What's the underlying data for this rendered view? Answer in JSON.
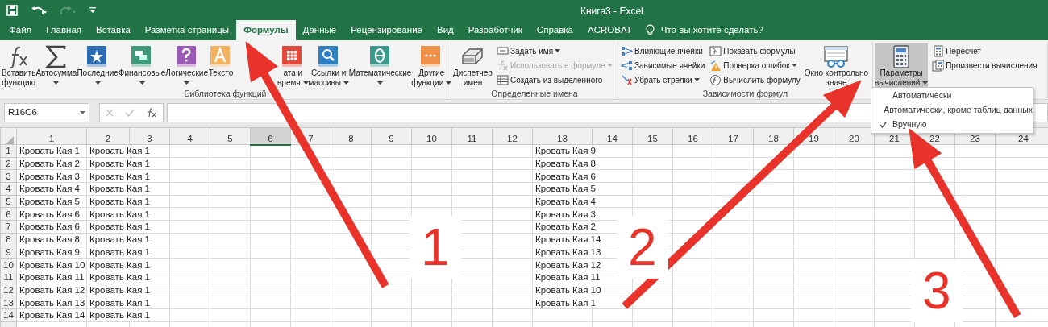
{
  "window": {
    "title": "Книга3  -  Excel"
  },
  "tabs": [
    {
      "label": "Файл",
      "selected": false
    },
    {
      "label": "Главная",
      "selected": false
    },
    {
      "label": "Вставка",
      "selected": false
    },
    {
      "label": "Разметка страницы",
      "selected": false
    },
    {
      "label": "Формулы",
      "selected": true
    },
    {
      "label": "Данные",
      "selected": false
    },
    {
      "label": "Рецензирование",
      "selected": false
    },
    {
      "label": "Вид",
      "selected": false
    },
    {
      "label": "Разработчик",
      "selected": false
    },
    {
      "label": "Справка",
      "selected": false
    },
    {
      "label": "ACROBAT",
      "selected": false
    }
  ],
  "tell_me": {
    "text": "Что вы хотите сделать?"
  },
  "ribbon": {
    "groups": [
      {
        "label": "Библиотека функций",
        "items": [
          {
            "kind": "large",
            "lines": [
              "Вставить",
              "функцию"
            ],
            "dropdown": false,
            "pressed": false
          },
          {
            "kind": "large",
            "lines": [
              "Автосумма"
            ],
            "dropdown": true,
            "pressed": false
          },
          {
            "kind": "large",
            "lines": [
              "Последние"
            ],
            "dropdown": true,
            "pressed": false
          },
          {
            "kind": "large",
            "lines": [
              "Финансовые"
            ],
            "dropdown": true,
            "pressed": false
          },
          {
            "kind": "large",
            "lines": [
              "Логические"
            ],
            "dropdown": true,
            "pressed": false
          },
          {
            "kind": "large",
            "lines": [
              "Тексто"
            ],
            "dropdown": false,
            "pressed": false
          },
          {
            "kind": "large",
            "lines": [
              "ата и",
              "время"
            ],
            "dropdown": true,
            "pressed": false
          },
          {
            "kind": "large",
            "lines": [
              "Ссылки и",
              "массивы"
            ],
            "dropdown": true,
            "pressed": false
          },
          {
            "kind": "large",
            "lines": [
              "Математические"
            ],
            "dropdown": true,
            "pressed": false
          },
          {
            "kind": "large",
            "lines": [
              "Другие",
              "функции"
            ],
            "dropdown": true,
            "pressed": false
          }
        ]
      },
      {
        "label": "Определенные имена",
        "items": [
          {
            "kind": "large",
            "lines": [
              "Диспетчер",
              "имен"
            ],
            "dropdown": false,
            "pressed": false
          },
          {
            "kind": "stack",
            "items": [
              {
                "label": "Задать имя",
                "dropdown": true,
                "disabled": false
              },
              {
                "label": "Использовать в формуле",
                "dropdown": true,
                "disabled": true
              },
              {
                "label": "Создать из выделенного",
                "dropdown": false,
                "disabled": false
              }
            ]
          }
        ]
      },
      {
        "label": "Зависимости формул",
        "items": [
          {
            "kind": "stack",
            "items": [
              {
                "label": "Влияющие ячейки",
                "dropdown": false,
                "disabled": false
              },
              {
                "label": "Зависимые ячейки",
                "dropdown": false,
                "disabled": false
              },
              {
                "label": "Убрать стрелки",
                "dropdown": true,
                "disabled": false
              }
            ]
          },
          {
            "kind": "stack",
            "items": [
              {
                "label": "Показать формулы",
                "dropdown": false,
                "disabled": false
              },
              {
                "label": "Проверка ошибок",
                "dropdown": true,
                "disabled": false
              },
              {
                "label": "Вычислить формулу",
                "dropdown": false,
                "disabled": false
              }
            ]
          },
          {
            "kind": "large",
            "lines": [
              "Окно контрольно",
              "значе"
            ],
            "dropdown": false,
            "pressed": false
          }
        ]
      },
      {
        "items": [
          {
            "kind": "large",
            "lines": [
              "Параметры",
              "вычислений"
            ],
            "dropdown": true,
            "pressed": true
          },
          {
            "kind": "stack",
            "items": [
              {
                "label": "Пересчет",
                "dropdown": false,
                "disabled": false
              },
              {
                "label": "Произвести вычисления",
                "dropdown": false,
                "disabled": false
              }
            ]
          }
        ]
      }
    ]
  },
  "calc_menu": [
    {
      "label": "Автоматически",
      "checked": false
    },
    {
      "label": "Автоматически, кроме таблиц данных",
      "checked": false
    },
    {
      "label": "Вручную",
      "checked": true
    }
  ],
  "formula_bar": {
    "name_box": "R16C6"
  },
  "sheet": {
    "columns": [
      {
        "label": "1",
        "selected": false
      },
      {
        "label": "2",
        "selected": false
      },
      {
        "label": "3",
        "selected": false
      },
      {
        "label": "4",
        "selected": false
      },
      {
        "label": "5",
        "selected": false
      },
      {
        "label": "6",
        "selected": true
      },
      {
        "label": "7",
        "selected": false
      },
      {
        "label": "8",
        "selected": false
      },
      {
        "label": "9",
        "selected": false
      },
      {
        "label": "10",
        "selected": false
      },
      {
        "label": "11",
        "selected": false
      },
      {
        "label": "12",
        "selected": false
      },
      {
        "label": "13",
        "selected": false
      },
      {
        "label": "14",
        "selected": false
      },
      {
        "label": "15",
        "selected": false
      },
      {
        "label": "16",
        "selected": false
      },
      {
        "label": "17",
        "selected": false
      },
      {
        "label": "18",
        "selected": false
      },
      {
        "label": "19",
        "selected": false
      },
      {
        "label": "20",
        "selected": false
      },
      {
        "label": "21",
        "selected": false
      },
      {
        "label": "22",
        "selected": false
      },
      {
        "label": "23",
        "selected": false
      },
      {
        "label": "24",
        "selected": false
      }
    ],
    "rows": [
      {
        "header": "1",
        "column_1": "Кровать Кая 1",
        "column_2": "Кровать Кая 1",
        "column_13": "Кровать Кая 9"
      },
      {
        "header": "2",
        "column_1": "Кровать Кая 2",
        "column_2": "Кровать Кая 1",
        "column_13": "Кровать Кая 8"
      },
      {
        "header": "3",
        "column_1": "Кровать Кая 3",
        "column_2": "Кровать Кая 1",
        "column_13": "Кровать Кая 6"
      },
      {
        "header": "4",
        "column_1": "Кровать Кая 4",
        "column_2": "Кровать Кая 1",
        "column_13": "Кровать Кая 5"
      },
      {
        "header": "5",
        "column_1": "Кровать Кая 5",
        "column_2": "Кровать Кая 1",
        "column_13": "Кровать Кая 4"
      },
      {
        "header": "6",
        "column_1": "Кровать Кая 6",
        "column_2": "Кровать Кая 1",
        "column_13": "Кровать Кая 3"
      },
      {
        "header": "7",
        "column_1": "Кровать Кая 6",
        "column_2": "Кровать Кая 1",
        "column_13": "Кровать Кая 2"
      },
      {
        "header": "8",
        "column_1": "Кровать Кая 8",
        "column_2": "Кровать Кая 1",
        "column_13": "Кровать Кая 14"
      },
      {
        "header": "9",
        "column_1": "Кровать Кая 9",
        "column_2": "Кровать Кая 1",
        "column_13": "Кровать Кая 13"
      },
      {
        "header": "10",
        "column_1": "Кровать Кая 10",
        "column_2": "Кровать Кая 1",
        "column_13": "Кровать Кая 12"
      },
      {
        "header": "11",
        "column_1": "Кровать Кая 11",
        "column_2": "Кровать Кая 1",
        "column_13": "Кровать Кая 11"
      },
      {
        "header": "12",
        "column_1": "Кровать Кая 12",
        "column_2": "Кровать Кая 1",
        "column_13": "Кровать Кая 10"
      },
      {
        "header": "13",
        "column_1": "Кровать Кая 13",
        "column_2": "Кровать Кая 1",
        "column_13": "Кровать Кая 1"
      },
      {
        "header": "14",
        "column_1": "Кровать Кая 14",
        "column_2": "Кровать Кая 1"
      }
    ]
  },
  "annotations": [
    {
      "label": "1"
    },
    {
      "label": "2"
    },
    {
      "label": "3"
    }
  ]
}
